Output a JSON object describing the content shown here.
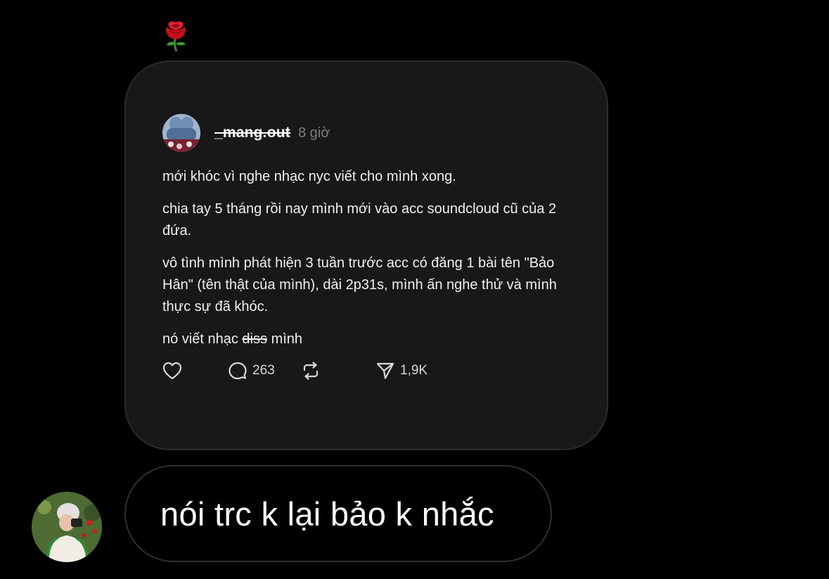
{
  "reaction": {
    "emoji_icon": "rose-icon"
  },
  "shared_post": {
    "username": "_mang.out",
    "time": "8 giờ",
    "paragraphs": [
      "mới khóc vì nghe nhạc nyc viết cho mình xong.",
      "chia tay 5 tháng rồi nay mình mới vào acc soundcloud cũ của 2 đứa.",
      "vô tình mình phát hiện 3 tuần trước acc có đăng 1 bài tên \"Bảo Hân\" (tên thật của mình), dài 2p31s, mình ấn nghe thử và mình thực sự đã khóc."
    ],
    "last_line": {
      "before": "nó viết nhạc",
      "struck": "diss",
      "after": "mình"
    },
    "stats": {
      "replies": "263",
      "shares": "1,9K"
    }
  },
  "message": {
    "text": "nói trc k lại bảo k nhắc"
  },
  "colors": {
    "background": "#000000",
    "card": "#181818",
    "muted": "#7d7d7d"
  }
}
